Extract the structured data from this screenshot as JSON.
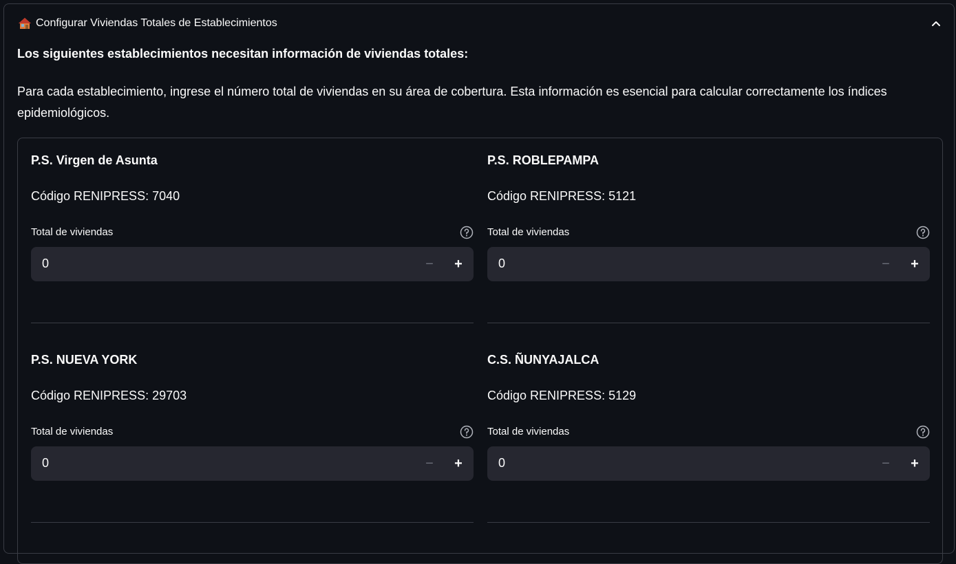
{
  "expander": {
    "icon": "house-icon",
    "title": "Configurar Viviendas Totales de Establecimientos",
    "expanded": true
  },
  "intro": {
    "heading": "Los siguientes establecimientos necesitan información de viviendas totales:",
    "text": "Para cada establecimiento, ingrese el número total de viviendas en su área de cobertura. Esta información es esencial para calcular correctamente los índices epidemiológicos."
  },
  "establishments": [
    {
      "name": "P.S. Virgen de Asunta",
      "code": "Código RENIPRESS: 7040",
      "label": "Total de viviendas",
      "value": "0"
    },
    {
      "name": "P.S. ROBLEPAMPA",
      "code": "Código RENIPRESS: 5121",
      "label": "Total de viviendas",
      "value": "0"
    },
    {
      "name": "P.S. NUEVA YORK",
      "code": "Código RENIPRESS: 29703",
      "label": "Total de viviendas",
      "value": "0"
    },
    {
      "name": "C.S. ÑUNYAJALCA",
      "code": "Código RENIPRESS: 5129",
      "label": "Total de viviendas",
      "value": "0"
    }
  ],
  "stepper": {
    "minus": "−",
    "plus": "+"
  },
  "colors": {
    "background": "#0e1117",
    "input_bg": "#262730",
    "border": "#3a3d45",
    "text": "#fafafa",
    "muted": "#6b6e78"
  }
}
